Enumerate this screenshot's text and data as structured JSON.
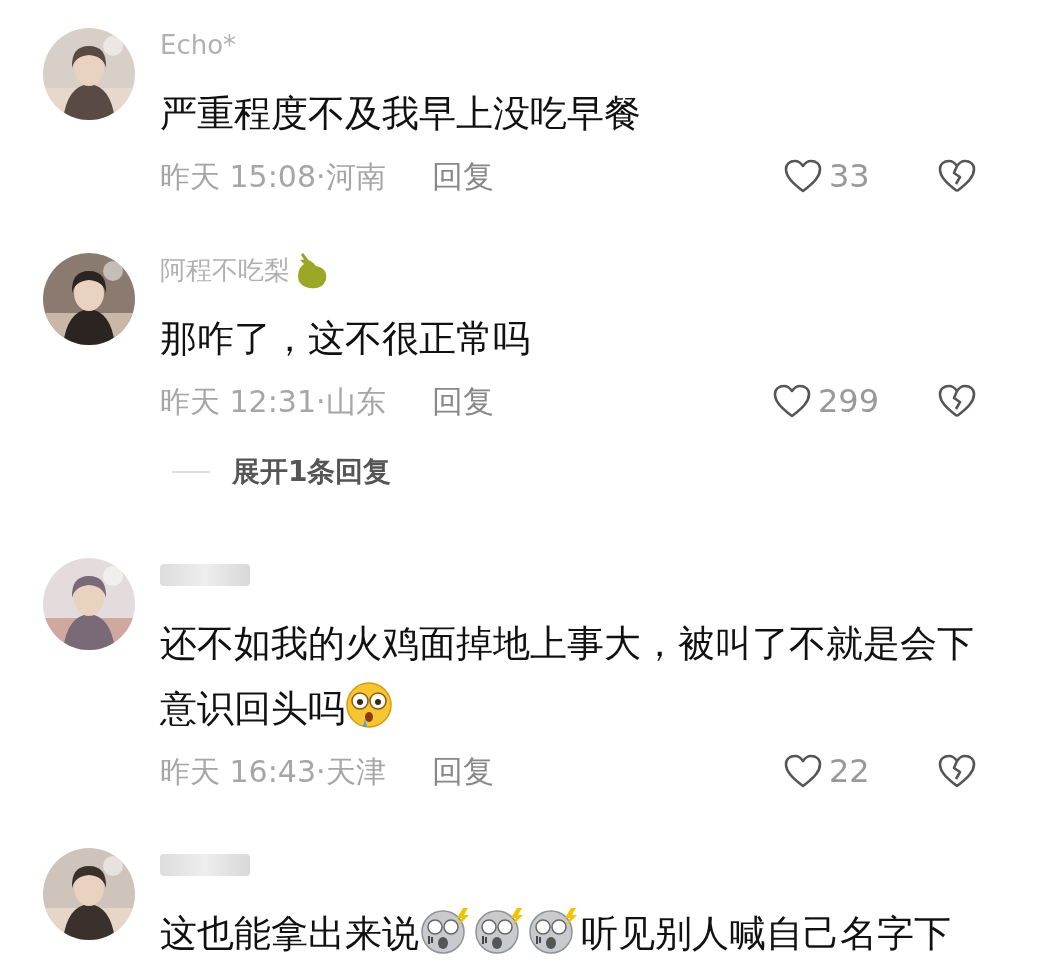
{
  "comments": [
    {
      "avatar": {
        "kind": "picture"
      },
      "name": "Echo*",
      "sticker": false,
      "parts": [
        {
          "kind": "text",
          "text": "严重程度不及我早上没吃早餐"
        }
      ],
      "time": "昨天 15:08·河南",
      "reply": "回复",
      "likes": "33"
    },
    {
      "avatar": {
        "kind": "picture"
      },
      "name": "阿程不吃梨",
      "sticker": true,
      "parts": [
        {
          "kind": "text",
          "text": "那咋了，这不很正常吗"
        }
      ],
      "time": "昨天 12:31·山东",
      "reply": "回复",
      "likes": "299",
      "expand": "展开1条回复"
    },
    {
      "avatar": {
        "kind": "picture"
      },
      "sticker": false,
      "parts": [
        {
          "kind": "text",
          "text": "还不如我的火鸡面掉地上事大，被叫了不就是会下意识回头吗"
        },
        {
          "kind": "flushed"
        }
      ],
      "time": "昨天 16:43·天津",
      "reply": "回复",
      "likes": "22"
    },
    {
      "avatar": {
        "kind": "picture"
      },
      "sticker": false,
      "parts": [
        {
          "kind": "text",
          "text": "这也能拿出来说"
        },
        {
          "kind": "shock"
        },
        {
          "kind": "shock"
        },
        {
          "kind": "shock"
        },
        {
          "kind": "text",
          "text": "听见别人喊自己名字下"
        }
      ]
    }
  ]
}
